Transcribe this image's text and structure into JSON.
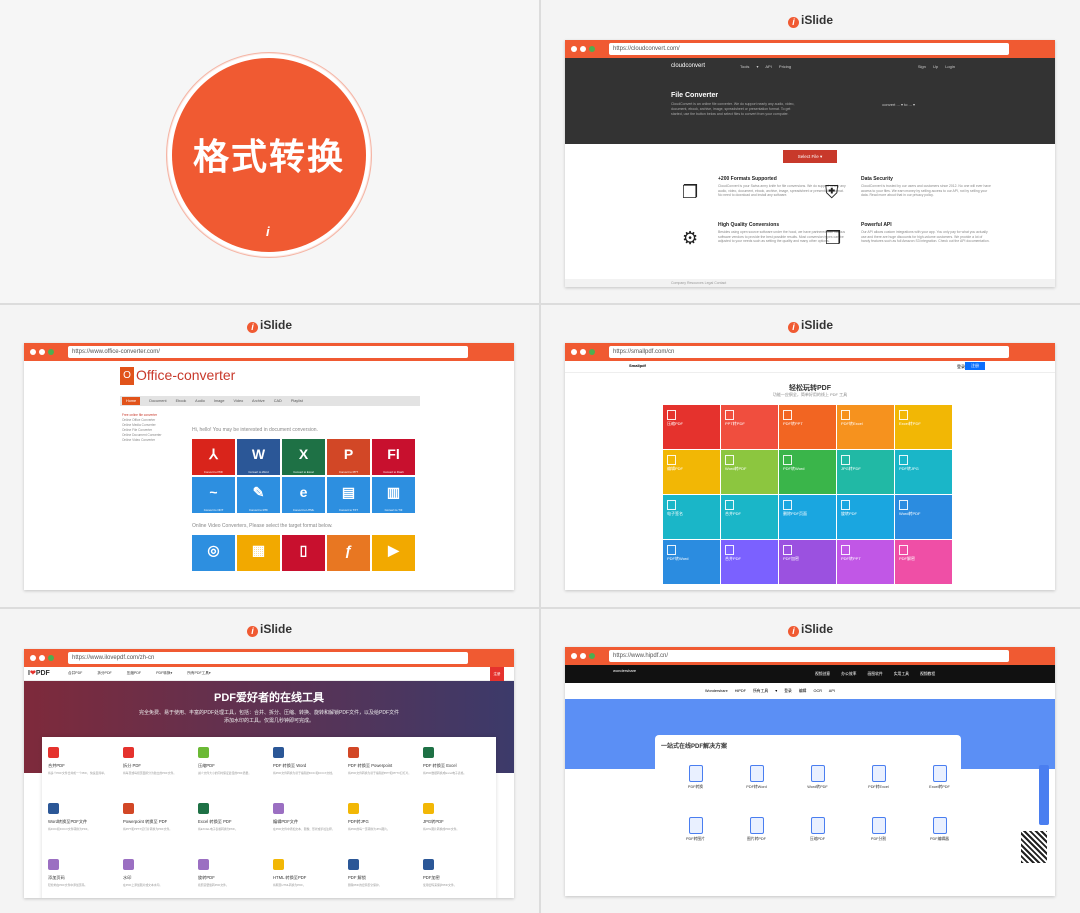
{
  "cover": {
    "title": "格式转换",
    "mark": "i"
  },
  "brand": {
    "name": "iSlide",
    "icon": "i"
  },
  "cloudconvert": {
    "url": "https://cloudconvert.com/",
    "logo": "cloudconvert",
    "links": "Tools ▾   API   Pricing",
    "auth": "Sign Up   Login",
    "heading": "File Converter",
    "desc": "CloudConvert is an online file converter. We do support nearly any audio, video, document, ebook, archive, image, spreadsheet or presentation format. To get started, use the button below and select files to convert from your computer.",
    "convert": "convert  ... ▾   to   ... ▾",
    "select": "Select File ▾",
    "features": [
      {
        "title": "+200 Formats Supported",
        "icon": "file-copy-icon",
        "text": "CloudConvert is your Swiss army knife for file conversions. We do support nearly any audio, video, document, ebook, archive, image, spreadsheet or presentation format. No need to download and install any software."
      },
      {
        "title": "Data Security",
        "icon": "shield-icon",
        "text": "CloudConvert is trusted by our users and customers since 2012. No one will ever have access to your files. We earn money by selling access to our API, not by selling your data. Read more about that in our privacy policy."
      },
      {
        "title": "High Quality Conversions",
        "icon": "gears-icon",
        "text": "Besides using open source software under the hood, we have partnered with various software vendors to provide the best possible results. Most conversion types can be adjusted to your needs such as setting the quality and many other options."
      },
      {
        "title": "Powerful API",
        "icon": "cubes-icon",
        "text": "Our API allows custom integrations with your app. You only pay for what you actually use and there are huge discounts for high-volume customers. We provide a lot of handy features such as full Amazon S3 integration. Check out the API documentation."
      }
    ],
    "footer": "Company    Resources    Legal    Contact"
  },
  "office": {
    "url": "https://www.office-converter.com/",
    "logo": "Office-converter",
    "nav_active": "Home",
    "nav": "Document   Ebook   Audio   Image   Video   Archive   CAD   Playlist",
    "side": [
      "Free online file converter",
      "Online Office Converter",
      "Online Media Converter",
      "Online File Converter",
      "Online Document Converter",
      "Online Video Converter"
    ],
    "prompt1": "Hi, hello! You may be interested in document conversion.",
    "prompt2": "Online Video Converters, Please select the target format below.",
    "row1": [
      {
        "g": "⅄",
        "l": "Convert to PDF",
        "c": "#d9241b"
      },
      {
        "g": "W",
        "l": "Convert to Word",
        "c": "#2b5797"
      },
      {
        "g": "X",
        "l": "Convert to Excel",
        "c": "#1e7145"
      },
      {
        "g": "P",
        "l": "Convert to PPT",
        "c": "#d24726"
      },
      {
        "g": "Fl",
        "l": "Convert to Flash",
        "c": "#c8102e"
      }
    ],
    "row2": [
      {
        "g": "~",
        "l": "Convert to ODT",
        "c": "#2d8fe0"
      },
      {
        "g": "✎",
        "l": "Convert to RTF",
        "c": "#2d8fe0"
      },
      {
        "g": "e",
        "l": "Convert to HTML",
        "c": "#2d8fe0"
      },
      {
        "g": "▤",
        "l": "Convert to TXT",
        "c": "#2d8fe0"
      },
      {
        "g": "▥",
        "l": "Convert to TIF",
        "c": "#2d8fe0"
      }
    ],
    "row3": [
      {
        "g": "◎",
        "l": "",
        "c": "#2d8fe0"
      },
      {
        "g": "▦",
        "l": "",
        "c": "#f2a900"
      },
      {
        "g": "▯",
        "l": "",
        "c": "#c8102e"
      },
      {
        "g": "ƒ",
        "l": "",
        "c": "#e87722"
      },
      {
        "g": "▶",
        "l": "",
        "c": "#f2a900"
      }
    ]
  },
  "smallpdf": {
    "url": "https://smallpdf.com/cn",
    "logo": "Smallpdf",
    "login": "登录",
    "signup": "注册",
    "title": "轻松玩转PDF",
    "subtitle": "功能一应俱全，简单好用的线上 PDF 工具",
    "tools": [
      {
        "n": "压缩PDF",
        "c": "#e5322d"
      },
      {
        "n": "PPT转PDF",
        "c": "#f04e3e"
      },
      {
        "n": "PDF转PPT",
        "c": "#f26522"
      },
      {
        "n": "PDF转Excel",
        "c": "#f6921e"
      },
      {
        "n": "Excel转PDF",
        "c": "#f2b705"
      },
      {
        "n": "编辑PDF",
        "c": "#f2b705"
      },
      {
        "n": "Word转PDF",
        "c": "#8cc63f"
      },
      {
        "n": "PDF转Word",
        "c": "#3ab54a"
      },
      {
        "n": "JPG转PDF",
        "c": "#21b9a5"
      },
      {
        "n": "PDF转JPG",
        "c": "#1ab6c8"
      },
      {
        "n": "电子签名",
        "c": "#1ab6c8"
      },
      {
        "n": "合并PDF",
        "c": "#1ab6c8"
      },
      {
        "n": "删除PDF页面",
        "c": "#1aa6e0"
      },
      {
        "n": "旋转PDF",
        "c": "#1aa6e0"
      },
      {
        "n": "Word转PDF",
        "c": "#2b8ce0"
      },
      {
        "n": "PDF转Word",
        "c": "#2b8ce0"
      },
      {
        "n": "合并PDF",
        "c": "#7b61ff"
      },
      {
        "n": "PDF加密",
        "c": "#9b51e0"
      },
      {
        "n": "PDF转PPT",
        "c": "#c157e6"
      },
      {
        "n": "PDF解密",
        "c": "#ef4fa6"
      }
    ]
  },
  "ilovepdf": {
    "url": "https://www.ilovepdf.com/zh-cn",
    "logo_prefix": "I",
    "logo_heart": "❤",
    "logo_suffix": "PDF",
    "links": "合并PDF  拆分PDF  压缩PDF  PDF转换▾  所有PDF工具▾",
    "signup": "注册",
    "title": "PDF爱好者的在线工具",
    "subtitle": "完全免费、易于使用、丰富的PDF处理工具，包括：合并、拆分、压缩、转换、旋转和解锁PDF文件，以及给PDF文件添加水印的工具。仅需几秒钟即可完成。",
    "tools": [
      {
        "n": "合并PDF",
        "c": "#e5322d",
        "d": "将多个PDF文件合并成一个PDF，快速且简单。"
      },
      {
        "n": "拆分 PDF",
        "c": "#e5322d",
        "d": "将每页或每组页面拆分为独立的PDF文件。"
      },
      {
        "n": "压缩PDF",
        "c": "#6bb935",
        "d": "减少文件大小的同时保证最佳的PDF质量。"
      },
      {
        "n": "PDF 转换至 Word",
        "c": "#2b5797",
        "d": "将PDF文件转换为易于编辑的DOC和DOCX文档。"
      },
      {
        "n": "PDF 转换至 Powerpoint",
        "c": "#d24726",
        "d": "将PDF文件转换为易于编辑的PPT和PPTX幻灯片。"
      },
      {
        "n": "PDF 转换至 Excel",
        "c": "#1e7145",
        "d": "将PDF数据转换成Excel电子表格。"
      },
      {
        "n": "Word转换至PDF文件",
        "c": "#2b5797",
        "d": "将DOC和DOCX文件转换为PDF。"
      },
      {
        "n": "Powerpoint 转换至 PDF",
        "c": "#d24726",
        "d": "将PPT和PPTX幻灯片转换为PDF文件。"
      },
      {
        "n": "Excel 转换至 PDF",
        "c": "#1e7145",
        "d": "将EXCEL电子表格转换为PDF。"
      },
      {
        "n": "编辑PDF文件",
        "c": "#9b6fc2",
        "d": "在PDF文件中添加文本、图像、形状或手绘注释。"
      },
      {
        "n": "PDF转JPG",
        "c": "#f2b705",
        "d": "将PDF的每一页转换为JPG图片。"
      },
      {
        "n": "JPG转PDF",
        "c": "#f2b705",
        "d": "将JPG图片转换成PDF文件。"
      },
      {
        "n": "添加页码",
        "c": "#9b6fc2",
        "d": "轻松地在PDF文件中添加页码。"
      },
      {
        "n": "水印",
        "c": "#9b6fc2",
        "d": "在PDF上添加图片或文本水印。"
      },
      {
        "n": "旋转PDF",
        "c": "#9b6fc2",
        "d": "按照需要旋转PDF文件。"
      },
      {
        "n": "HTML 转换至PDF",
        "c": "#f2b705",
        "d": "将网页HTML转换为PDF。"
      },
      {
        "n": "PDF 解锁",
        "c": "#2b5797",
        "d": "删除PDF的密码安全保护。"
      },
      {
        "n": "PDF加密",
        "c": "#2b5797",
        "d": "使用密码来保护PDF文件。"
      }
    ]
  },
  "hipdf": {
    "url": "https://www.hipdf.cn/",
    "brand": "wondershare",
    "menu": "视频创意   办公效率   画图软件   实用工具   视频教程",
    "sub": "Wondershare HiPDF  所有工具 ▾  登录  编辑  OCR  API",
    "title": "一站式在线PDF解决方案",
    "tools": [
      "PDF转换",
      "PDF转Word",
      "Word转PDF",
      "PDF转Excel",
      "Excel转PDF",
      "PDF转图片",
      "图片转PDF",
      "压缩PDF",
      "PDF分割",
      "PDF编辑器"
    ]
  }
}
